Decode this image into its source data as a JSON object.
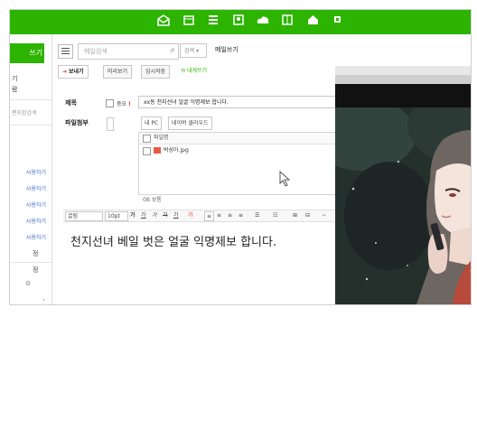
{
  "topbar": {
    "icons": [
      "mail-icon",
      "calendar-icon",
      "list-icon",
      "contacts-icon",
      "cloud-icon",
      "notes-icon",
      "home-icon",
      "settings-icon"
    ]
  },
  "sidebar": {
    "write_label": "쓰기",
    "item1": "기",
    "item2": "람",
    "search_hint": "편지함검색",
    "links": [
      "사용하기",
      "사용하기",
      "사용하기",
      "사용하기",
      "사용하기"
    ],
    "lower1": "정",
    "lower2": "정"
  },
  "search": {
    "placeholder": "메일검색",
    "scope_label": "검색 ▾"
  },
  "compose": {
    "title": "메일쓰기",
    "toolbar": {
      "send": "보내기",
      "preview": "미리보기",
      "save": "임시저장",
      "to_me": "내게쓰기"
    },
    "subject_label": "제목",
    "important_label": "중요",
    "important_mark": "!",
    "subject_value": "xx동 천지선녀 얼굴 익명제보 합니다.",
    "attach_label": "파일첨부",
    "attach_buttons": [
      "내 PC",
      "네이버 클라우드"
    ],
    "attach_header": "파일명",
    "attach_file": "박성아.jpg",
    "attach_size": "0B 보통",
    "editor": {
      "font": "굴림",
      "size": "10pt",
      "tools": [
        "가",
        "가",
        "가",
        "가",
        "가",
        "가"
      ],
      "list_tools": [
        "≡",
        "≡",
        "≡",
        "≡"
      ]
    },
    "body_text": "천지선녀 베일 벗은 얼굴 익명제보 합니다."
  },
  "colors": {
    "brand": "#2db400",
    "accent_red": "#e0321c"
  }
}
